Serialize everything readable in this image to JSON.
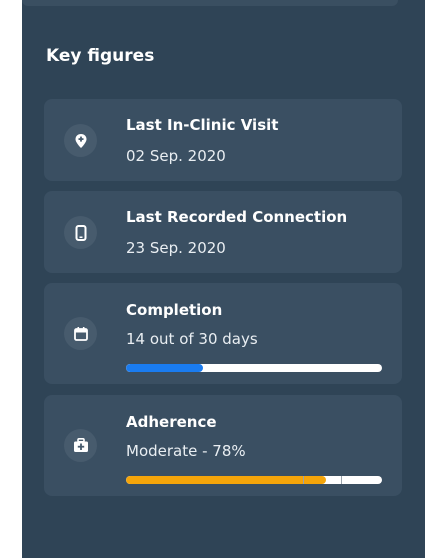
{
  "section": {
    "title": "Key figures"
  },
  "cards": [
    {
      "icon": "location-pin-icon",
      "title": "Last In-Clinic Visit",
      "value": "02 Sep. 2020"
    },
    {
      "icon": "phone-icon",
      "title": "Last Recorded Connection",
      "value": "23 Sep. 2020"
    },
    {
      "icon": "calendar-icon",
      "title": "Completion",
      "value": "14 out of 30 days",
      "progress": 0.3,
      "progress_color": "#1a7cf0"
    },
    {
      "icon": "medical-kit-icon",
      "title": "Adherence",
      "value": "Moderate - 78%",
      "progress": 0.78,
      "progress_color": "#f5a50a",
      "threshold_markers": [
        0.69,
        0.84
      ]
    }
  ],
  "colors": {
    "panel_bg": "#2f4456",
    "card_bg": "#3a4f62",
    "icon_bg": "#475b6d",
    "track_bg": "#ffffff"
  }
}
